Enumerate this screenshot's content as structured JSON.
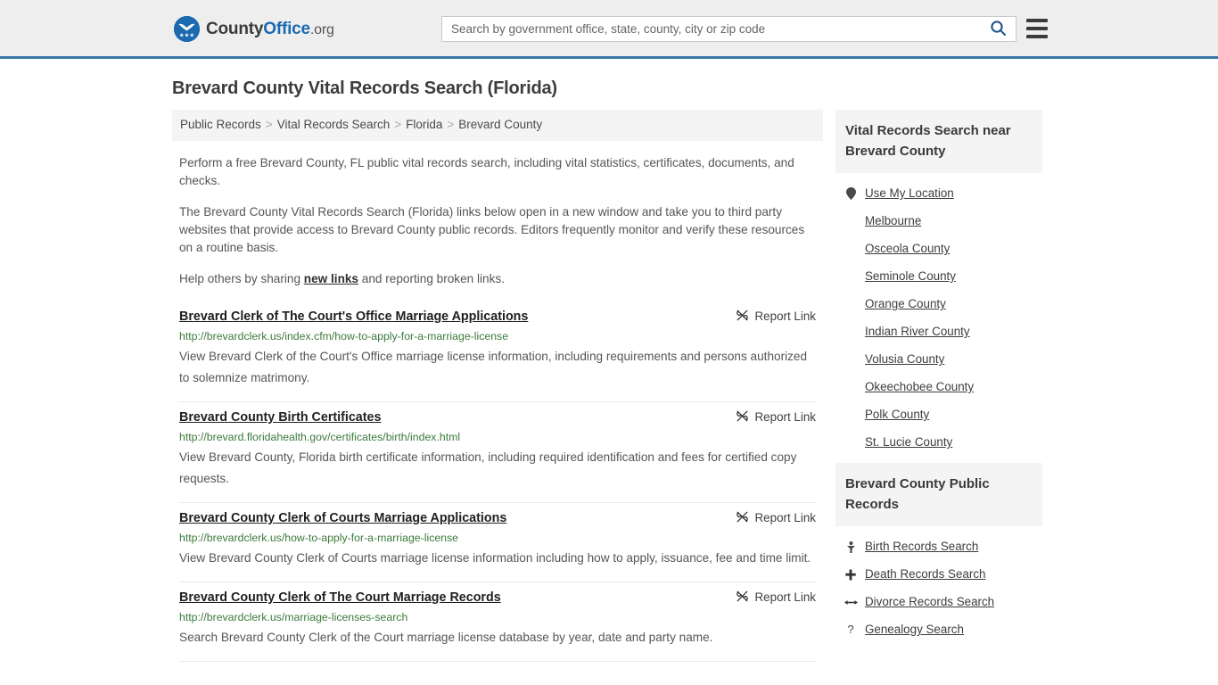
{
  "header": {
    "brand": {
      "part1": "County",
      "part2": "Office",
      "part3": ".org",
      "logo_icon": "eagle-stars-logo"
    },
    "search": {
      "placeholder": "Search by government office, state, county, city or zip code",
      "value": "",
      "icon": "search-icon"
    },
    "menu_icon": "hamburger-menu-icon"
  },
  "main": {
    "title": "Brevard County Vital Records Search (Florida)",
    "breadcrumb": [
      {
        "label": "Public Records"
      },
      {
        "label": "Vital Records Search"
      },
      {
        "label": "Florida"
      },
      {
        "label": "Brevard County"
      }
    ],
    "breadcrumb_separator": ">",
    "intro": {
      "p1": "Perform a free Brevard County, FL public vital records search, including vital statistics, certificates, documents, and checks.",
      "p2": "The Brevard County Vital Records Search (Florida) links below open in a new window and take you to third party websites that provide access to Brevard County public records. Editors frequently monitor and verify these resources on a routine basis.",
      "p3_before": "Help others by sharing ",
      "p3_link": "new links",
      "p3_after": " and reporting broken links."
    },
    "report_link_label": "Report Link",
    "report_link_icon": "broken-link-icon",
    "results": [
      {
        "title": "Brevard Clerk of The Court's Office Marriage Applications",
        "url": "http://brevardclerk.us/index.cfm/how-to-apply-for-a-marriage-license",
        "description": "View Brevard Clerk of the Court's Office marriage license information, including requirements and persons authorized to solemnize matrimony."
      },
      {
        "title": "Brevard County Birth Certificates",
        "url": "http://brevard.floridahealth.gov/certificates/birth/index.html",
        "description": "View Brevard County, Florida birth certificate information, including required identification and fees for certified copy requests."
      },
      {
        "title": "Brevard County Clerk of Courts Marriage Applications",
        "url": "http://brevardclerk.us/how-to-apply-for-a-marriage-license",
        "description": "View Brevard County Clerk of Courts marriage license information including how to apply, issuance, fee and time limit."
      },
      {
        "title": "Brevard County Clerk of The Court Marriage Records",
        "url": "http://brevardclerk.us/marriage-licenses-search",
        "description": "Search Brevard County Clerk of the Court marriage license database by year, date and party name."
      }
    ]
  },
  "sidebar": {
    "nearby": {
      "heading": "Vital Records Search near Brevard County",
      "items": [
        {
          "label": "Use My Location",
          "icon": "map-pin-icon"
        },
        {
          "label": "Melbourne",
          "icon": ""
        },
        {
          "label": "Osceola County",
          "icon": ""
        },
        {
          "label": "Seminole County",
          "icon": ""
        },
        {
          "label": "Orange County",
          "icon": ""
        },
        {
          "label": "Indian River County",
          "icon": ""
        },
        {
          "label": "Volusia County",
          "icon": ""
        },
        {
          "label": "Okeechobee County",
          "icon": ""
        },
        {
          "label": "Polk County",
          "icon": ""
        },
        {
          "label": "St. Lucie County",
          "icon": ""
        }
      ]
    },
    "public_records": {
      "heading": "Brevard County Public Records",
      "items": [
        {
          "label": "Birth Records Search",
          "icon": "baby-icon"
        },
        {
          "label": "Death Records Search",
          "icon": "cross-icon"
        },
        {
          "label": "Divorce Records Search",
          "icon": "left-right-arrow-icon"
        },
        {
          "label": "Genealogy Search",
          "icon": "question-mark-icon"
        }
      ]
    }
  },
  "colors": {
    "header_bg": "#eeeeee",
    "header_border": "#3b76a8",
    "brand_blue": "#1b6ab0",
    "url_green": "#3c7a3c",
    "panel_bg": "#f4f4f4"
  }
}
